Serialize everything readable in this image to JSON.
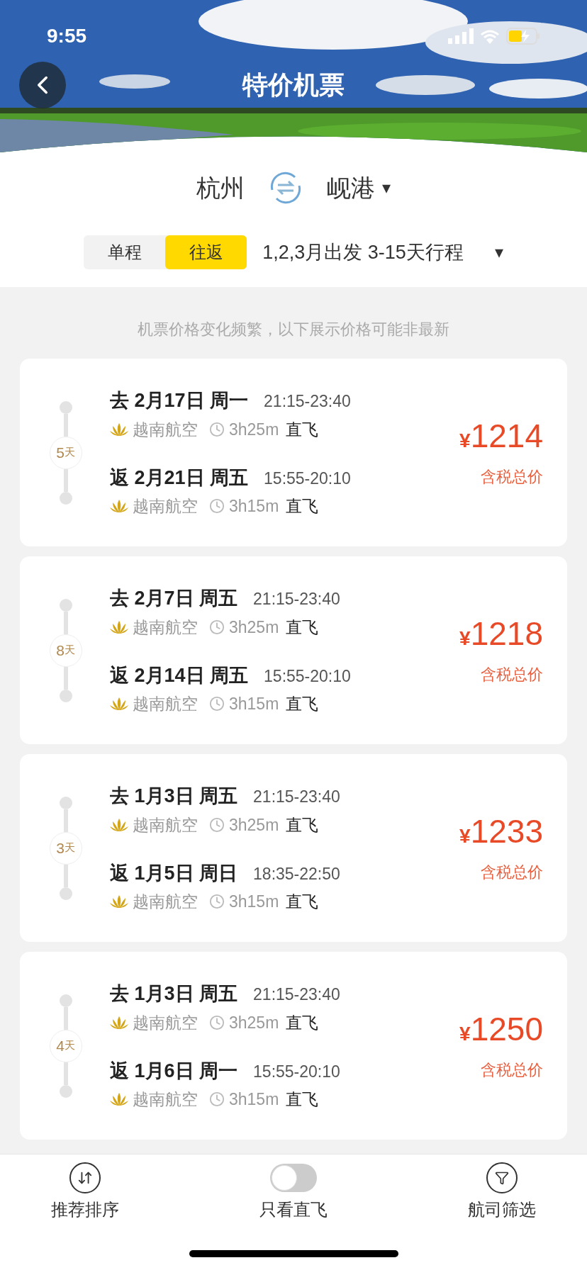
{
  "status_bar": {
    "time": "9:55"
  },
  "header": {
    "title": "特价机票"
  },
  "route": {
    "from": "杭州",
    "to": "岘港",
    "dropdown": "▾"
  },
  "trip_types": [
    {
      "label": "单程",
      "selected": false
    },
    {
      "label": "往返",
      "selected": true
    }
  ],
  "date_filter": {
    "label": "1,2,3月出发 3-15天行程",
    "dropdown": "▾"
  },
  "notice": "机票价格变化频繁，以下展示价格可能非最新",
  "flights": [
    {
      "days": "5",
      "days_unit": "天",
      "currency": "¥",
      "price": "1214",
      "price_note": "含税总价",
      "legs": [
        {
          "date": "去 2月17日 周一",
          "time": "21:15-23:40",
          "airline": "越南航空",
          "duration": "3h25m",
          "type": "直飞"
        },
        {
          "date": "返 2月21日 周五",
          "time": "15:55-20:10",
          "airline": "越南航空",
          "duration": "3h15m",
          "type": "直飞"
        }
      ]
    },
    {
      "days": "8",
      "days_unit": "天",
      "currency": "¥",
      "price": "1218",
      "price_note": "含税总价",
      "legs": [
        {
          "date": "去 2月7日 周五",
          "time": "21:15-23:40",
          "airline": "越南航空",
          "duration": "3h25m",
          "type": "直飞"
        },
        {
          "date": "返 2月14日 周五",
          "time": "15:55-20:10",
          "airline": "越南航空",
          "duration": "3h15m",
          "type": "直飞"
        }
      ]
    },
    {
      "days": "3",
      "days_unit": "天",
      "currency": "¥",
      "price": "1233",
      "price_note": "含税总价",
      "legs": [
        {
          "date": "去 1月3日 周五",
          "time": "21:15-23:40",
          "airline": "越南航空",
          "duration": "3h25m",
          "type": "直飞"
        },
        {
          "date": "返 1月5日 周日",
          "time": "18:35-22:50",
          "airline": "越南航空",
          "duration": "3h15m",
          "type": "直飞"
        }
      ]
    },
    {
      "days": "4",
      "days_unit": "天",
      "currency": "¥",
      "price": "1250",
      "price_note": "含税总价",
      "legs": [
        {
          "date": "去 1月3日 周五",
          "time": "21:15-23:40",
          "airline": "越南航空",
          "duration": "3h25m",
          "type": "直飞"
        },
        {
          "date": "返 1月6日 周一",
          "time": "15:55-20:10",
          "airline": "越南航空",
          "duration": "3h15m",
          "type": "直飞"
        }
      ]
    }
  ],
  "bottom_bar": [
    {
      "kind": "sort",
      "label": "推荐排序"
    },
    {
      "kind": "toggle",
      "label": "只看直飞",
      "on": false
    },
    {
      "kind": "filter",
      "label": "航司筛选"
    }
  ]
}
